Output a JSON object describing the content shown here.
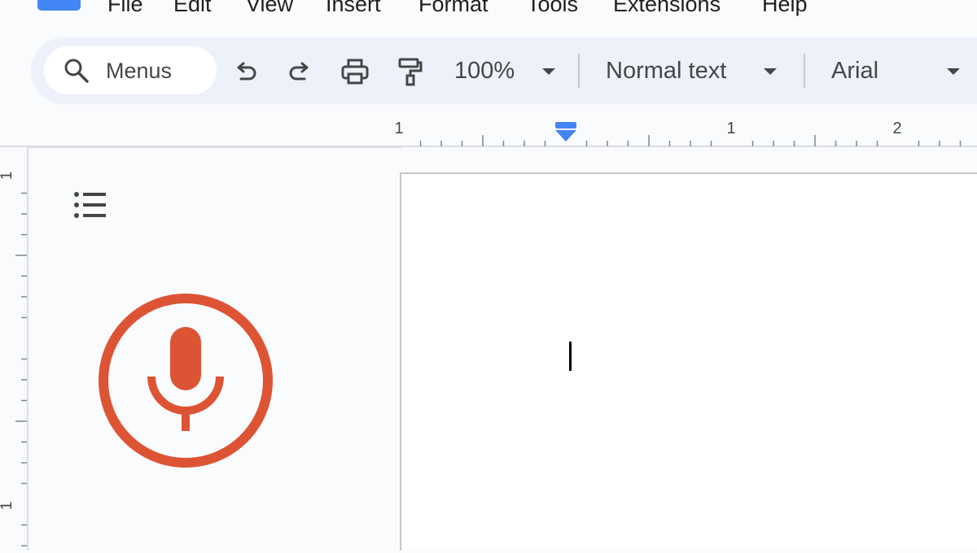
{
  "menu": {
    "items": [
      "File",
      "Edit",
      "View",
      "Insert",
      "Format",
      "Tools",
      "Extensions",
      "Help"
    ]
  },
  "toolbar": {
    "search_label": "Menus",
    "zoom": "100%",
    "style": "Normal text",
    "font": "Arial"
  },
  "ruler": {
    "horizontal_labels": [
      "1",
      "1",
      "2"
    ],
    "vertical_labels": [
      "1",
      "1"
    ]
  },
  "icons": {
    "search": "search-icon",
    "undo": "undo-icon",
    "redo": "redo-icon",
    "print": "print-icon",
    "paint_format": "paint-format-icon",
    "outline": "document-outline-icon",
    "mic": "microphone-icon",
    "indent": "indent-marker-icon"
  },
  "colors": {
    "mic": "#dd5434",
    "accent": "#4285f4",
    "toolbar_bg": "#edf2fa"
  }
}
